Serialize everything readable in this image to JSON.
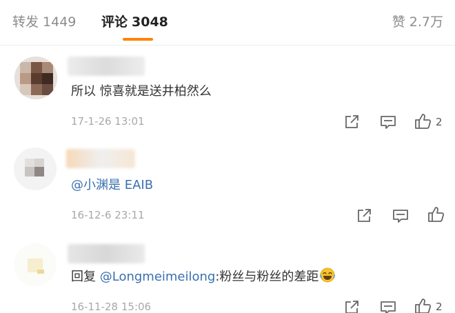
{
  "tabs": {
    "repost": {
      "label": "转发",
      "count": "1449"
    },
    "comments": {
      "label": "评论",
      "count": "3048"
    },
    "likes": {
      "label": "赞",
      "count": "2.7万"
    }
  },
  "comments": [
    {
      "text": "所以 惊喜就是送井柏然么",
      "time": "17-1-26 13:01",
      "likes": "2"
    },
    {
      "mention": "@小渊是 EAIB",
      "time": "16-12-6 23:11",
      "likes": ""
    },
    {
      "reply_prefix": "回复 ",
      "mention": "@Longmeimeilong",
      "text": ":粉丝与粉丝的差距",
      "emoji": "laughing-crying-emoji",
      "time": "16-11-28 15:06",
      "likes": "2"
    }
  ],
  "icons": [
    "share-icon",
    "comment-icon",
    "thumbs-up-icon"
  ],
  "colors": {
    "accent": "#ff8200",
    "link": "#3a6fb0",
    "muted": "#a8a8a8"
  }
}
